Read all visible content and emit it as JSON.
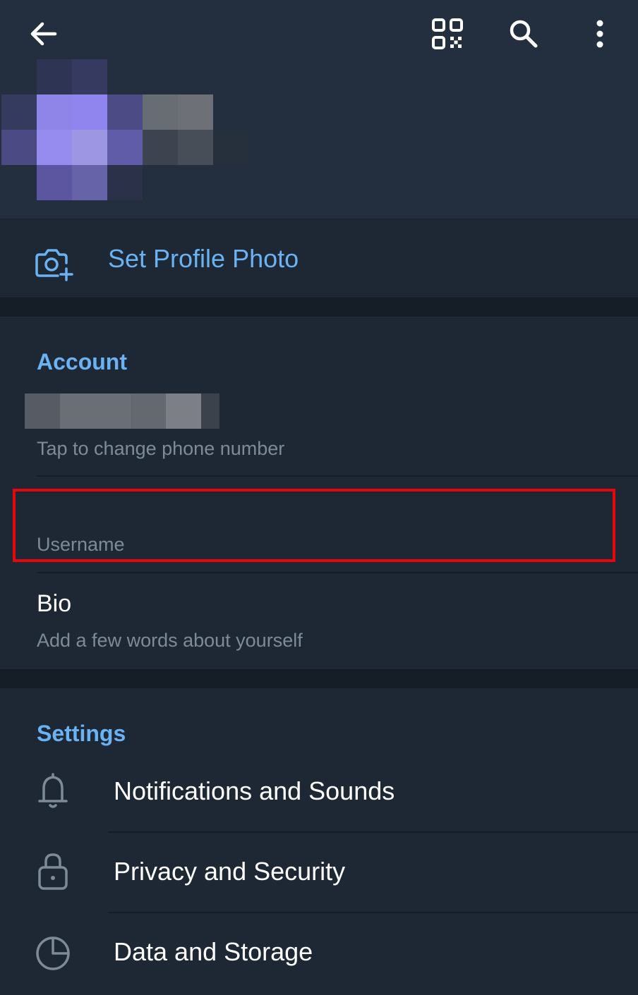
{
  "header": {
    "back_icon": "arrow-left-icon",
    "qr_icon": "qr-code-icon",
    "search_icon": "search-icon",
    "more_icon": "more-vertical-icon"
  },
  "profile": {
    "set_photo_label": "Set Profile Photo",
    "camera_icon": "camera-add-icon"
  },
  "account": {
    "title": "Account",
    "phone_hint": "Tap to change phone number",
    "username_label": "Username",
    "bio_title": "Bio",
    "bio_hint": "Add a few words about yourself"
  },
  "settings": {
    "title": "Settings",
    "items": [
      {
        "label": "Notifications and Sounds",
        "icon": "bell-icon"
      },
      {
        "label": "Privacy and Security",
        "icon": "lock-icon"
      },
      {
        "label": "Data and Storage",
        "icon": "pie-chart-icon"
      }
    ]
  },
  "colors": {
    "accent": "#6ab2f2",
    "highlight": "#e8060e",
    "background": "#1d2733"
  }
}
